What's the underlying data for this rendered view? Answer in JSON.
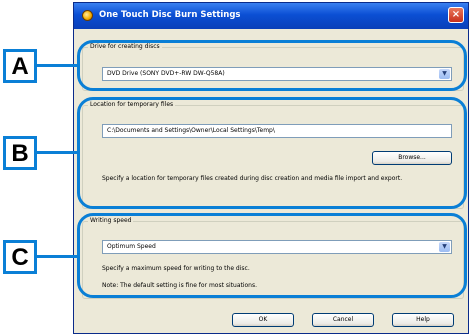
{
  "dialog": {
    "title": "One Touch Disc Burn Settings",
    "close_label": "×"
  },
  "drive": {
    "label": "Drive for creating discs",
    "value": "DVD Drive (SONY DVD+-RW DW-Q58A)"
  },
  "location": {
    "label": "Location for temporary files",
    "path": "C:\\Documents and Settings\\Owner\\Local Settings\\Temp\\",
    "browse_label": "Browse...",
    "description": "Specify a location for temporary files created during disc creation and media file import and export."
  },
  "speed": {
    "label": "Writing speed",
    "value": "Optimum Speed",
    "description": "Specify a maximum speed for writing to the disc.",
    "note": "Note: The default setting is fine for most situations."
  },
  "buttons": {
    "ok": "OK",
    "cancel": "Cancel",
    "help": "Help"
  },
  "callouts": {
    "a": "A",
    "b": "B",
    "c": "C"
  },
  "colors": {
    "callout": "#0a7fd6",
    "titlebar": "#0b4fd4",
    "dialog_bg": "#ece9d8"
  },
  "icons": {
    "title": "disc-burn-icon",
    "combo": "chevron-down-icon"
  }
}
